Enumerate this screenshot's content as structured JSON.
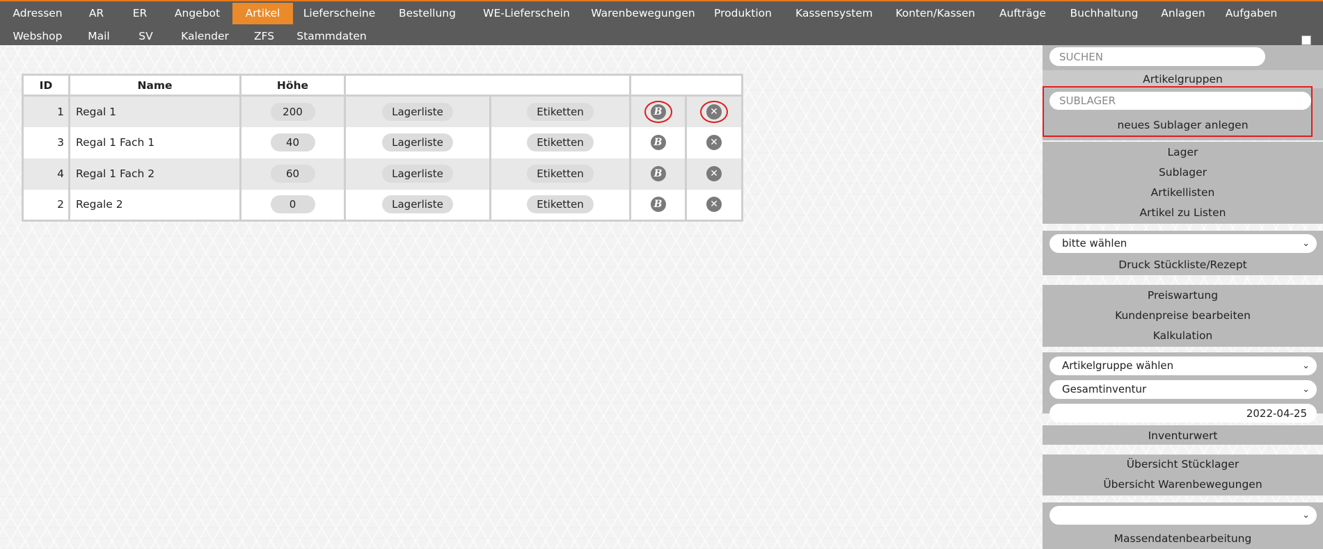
{
  "nav": {
    "row1": [
      {
        "label": "Adressen",
        "active": false
      },
      {
        "label": "AR",
        "active": false
      },
      {
        "label": "ER",
        "active": false
      },
      {
        "label": "Angebot",
        "active": false
      },
      {
        "label": "Artikel",
        "active": true
      },
      {
        "label": "Lieferscheine",
        "active": false
      },
      {
        "label": "Bestellung",
        "active": false
      },
      {
        "label": "WE-Lieferschein",
        "active": false
      },
      {
        "label": "Warenbewegungen",
        "active": false
      },
      {
        "label": "Produktion",
        "active": false
      },
      {
        "label": "Kassensystem",
        "active": false
      },
      {
        "label": "Konten/Kassen",
        "active": false
      },
      {
        "label": "Aufträge",
        "active": false
      },
      {
        "label": "Buchhaltung",
        "active": false
      },
      {
        "label": "Anlagen",
        "active": false
      },
      {
        "label": "Aufgaben",
        "active": false
      }
    ],
    "row2": [
      {
        "label": "Webshop"
      },
      {
        "label": "Mail"
      },
      {
        "label": "SV"
      },
      {
        "label": "Kalender"
      },
      {
        "label": "ZFS"
      },
      {
        "label": "Stammdaten"
      }
    ]
  },
  "table": {
    "headers": {
      "id": "ID",
      "name": "Name",
      "height": "Höhe"
    },
    "rows": [
      {
        "id": "1",
        "name": "Regal 1",
        "height": "200",
        "list": "Lagerliste",
        "labels": "Etiketten",
        "edit": "B"
      },
      {
        "id": "3",
        "name": "Regal 1 Fach 1",
        "height": "40",
        "list": "Lagerliste",
        "labels": "Etiketten",
        "edit": "B"
      },
      {
        "id": "4",
        "name": "Regal 1 Fach 2",
        "height": "60",
        "list": "Lagerliste",
        "labels": "Etiketten",
        "edit": "B"
      },
      {
        "id": "2",
        "name": "Regale 2",
        "height": "0",
        "list": "Lagerliste",
        "labels": "Etiketten",
        "edit": "B"
      }
    ]
  },
  "sidebar": {
    "search_placeholder": "SUCHEN",
    "artikelgruppen": "Artikelgruppen",
    "sublager_placeholder": "SUBLAGER",
    "new_sublager": "neues Sublager anlegen",
    "links1": [
      "Lager",
      "Sublager",
      "Artikellisten",
      "Artikel zu Listen"
    ],
    "select1": "bitte wählen",
    "druck": "Druck Stückliste/Rezept",
    "links2": [
      "Preiswartung",
      "Kundenpreise bearbeiten",
      "Kalkulation"
    ],
    "select_group": "Artikelgruppe wählen",
    "select_inventur": "Gesamtinventur",
    "date": "2022-04-25",
    "inventurwert": "Inventurwert",
    "links3": [
      "Übersicht Stücklager",
      "Übersicht Warenbewegungen"
    ],
    "select_empty": "",
    "massen": "Massendatenbearbeitung"
  },
  "icons": {
    "chevron": "chevron-down-icon",
    "delete": "close-icon",
    "edit": "edit-b-icon"
  },
  "colors": {
    "topbar": "#5b5b5b",
    "accent": "#ea8a2a",
    "highlight": "#e01b1b",
    "sidebar": "#b9b9b9"
  }
}
